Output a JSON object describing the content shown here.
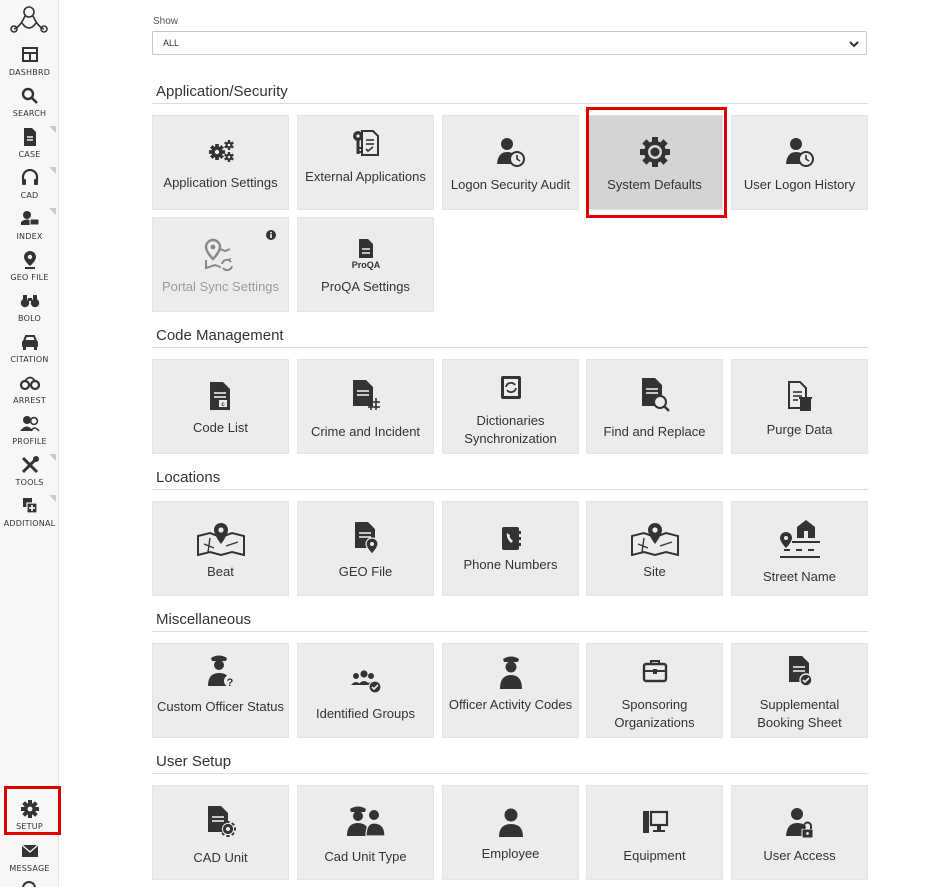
{
  "sidebar": {
    "items": [
      {
        "label": "DASHBRD",
        "icon": "dashboard-icon"
      },
      {
        "label": "SEARCH",
        "icon": "search-icon"
      },
      {
        "label": "CASE",
        "icon": "case-file-icon"
      },
      {
        "label": "CAD",
        "icon": "headset-icon"
      },
      {
        "label": "INDEX",
        "icon": "index-person-car-icon"
      },
      {
        "label": "GEO FILE",
        "icon": "map-pin-icon"
      },
      {
        "label": "BOLO",
        "icon": "binoculars-icon"
      },
      {
        "label": "CITATION",
        "icon": "car-icon"
      },
      {
        "label": "ARREST",
        "icon": "handcuffs-icon"
      },
      {
        "label": "PROFILE",
        "icon": "people-icon"
      },
      {
        "label": "TOOLS",
        "icon": "tools-icon"
      },
      {
        "label": "ADDITIONAL",
        "icon": "add-module-icon"
      },
      {
        "label": "SETUP",
        "icon": "gear-icon"
      },
      {
        "label": "MESSAGE",
        "icon": "envelope-icon"
      }
    ]
  },
  "filter": {
    "label": "Show",
    "value": "ALL"
  },
  "sections": [
    {
      "title": "Application/Security",
      "tiles": [
        {
          "label": "Application Settings",
          "icon": "gears-icon"
        },
        {
          "label": "External Applications",
          "icon": "key-document-icon"
        },
        {
          "label": "Logon Security Audit",
          "icon": "user-clock-icon"
        },
        {
          "label": "System Defaults",
          "icon": "gear-icon",
          "selected": true
        },
        {
          "label": "User Logon History",
          "icon": "user-clock-icon"
        },
        {
          "label": "Portal Sync Settings",
          "icon": "map-sync-icon",
          "disabled": true
        },
        {
          "label": "ProQA Settings",
          "icon": "proqa-document-icon"
        }
      ]
    },
    {
      "title": "Code Management",
      "tiles": [
        {
          "label": "Code List",
          "icon": "document-code-icon"
        },
        {
          "label": "Crime and Incident",
          "icon": "document-hash-icon"
        },
        {
          "label": "Dictionaries Synchronization",
          "icon": "book-sync-icon"
        },
        {
          "label": "Find and Replace",
          "icon": "document-search-icon"
        },
        {
          "label": "Purge Data",
          "icon": "document-trash-icon"
        }
      ]
    },
    {
      "title": "Locations",
      "tiles": [
        {
          "label": "Beat",
          "icon": "map-pin-icon"
        },
        {
          "label": "GEO File",
          "icon": "document-pin-icon"
        },
        {
          "label": "Phone Numbers",
          "icon": "phone-book-icon"
        },
        {
          "label": "Site",
          "icon": "map-pin-icon"
        },
        {
          "label": "Street Name",
          "icon": "street-house-icon"
        }
      ]
    },
    {
      "title": "Miscellaneous",
      "tiles": [
        {
          "label": "Custom Officer Status",
          "icon": "officer-question-icon"
        },
        {
          "label": "Identified Groups",
          "icon": "group-check-icon"
        },
        {
          "label": "Officer Activity Codes",
          "icon": "officer-icon"
        },
        {
          "label": "Sponsoring Organizations",
          "icon": "briefcase-icon"
        },
        {
          "label": "Supplemental Booking Sheet",
          "icon": "document-check-icon"
        }
      ]
    },
    {
      "title": "User Setup",
      "tiles": [
        {
          "label": "CAD Unit",
          "icon": "document-gear-icon"
        },
        {
          "label": "Cad Unit Type",
          "icon": "officers-icon"
        },
        {
          "label": "Employee",
          "icon": "user-icon"
        },
        {
          "label": "Equipment",
          "icon": "computer-icon"
        },
        {
          "label": "User Access",
          "icon": "user-lock-icon"
        }
      ]
    }
  ],
  "colors": {
    "tile_bg": "#ececec",
    "tile_selected_bg": "#d4d4d4",
    "highlight": "#e00000",
    "icon": "#333333"
  }
}
